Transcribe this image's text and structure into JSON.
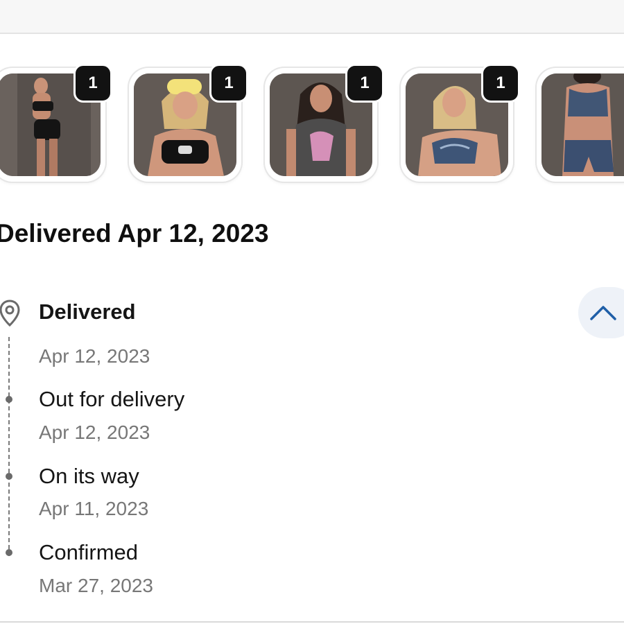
{
  "items": [
    {
      "qty": "1",
      "icon": "product-photo-black-shorts"
    },
    {
      "qty": "1",
      "icon": "product-photo-black-sports-bra"
    },
    {
      "qty": "1",
      "icon": "product-photo-graphic-tank"
    },
    {
      "qty": "1",
      "icon": "product-photo-blue-sports-bra"
    },
    {
      "qty": "",
      "icon": "product-photo-blue-set"
    }
  ],
  "delivery": {
    "title": "Delivered Apr 12, 2023"
  },
  "timeline": [
    {
      "label": "Delivered",
      "date": "Apr 12, 2023",
      "icon": "location-pin-icon"
    },
    {
      "label": "Out for delivery",
      "date": "Apr 12, 2023",
      "icon": "timeline-dot"
    },
    {
      "label": "On its way",
      "date": "Apr 11, 2023",
      "icon": "timeline-dot"
    },
    {
      "label": "Confirmed",
      "date": "Mar 27, 2023",
      "icon": "timeline-dot"
    }
  ],
  "controls": {
    "collapse_icon": "chevron-up-icon"
  },
  "colors": {
    "accent": "#1f5fa8",
    "badge_bg": "#121212",
    "collapse_bg": "#eef2f8",
    "muted_text": "#777777"
  }
}
